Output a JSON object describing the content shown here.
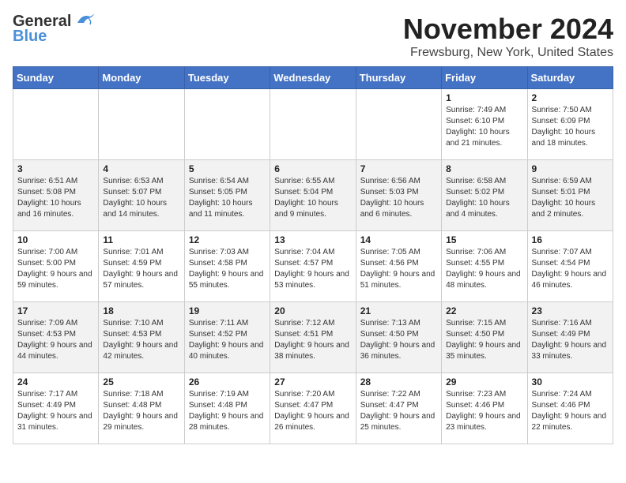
{
  "header": {
    "logo_line1": "General",
    "logo_line2": "Blue",
    "month_year": "November 2024",
    "location": "Frewsburg, New York, United States"
  },
  "weekdays": [
    "Sunday",
    "Monday",
    "Tuesday",
    "Wednesday",
    "Thursday",
    "Friday",
    "Saturday"
  ],
  "weeks": [
    [
      {
        "day": "",
        "info": ""
      },
      {
        "day": "",
        "info": ""
      },
      {
        "day": "",
        "info": ""
      },
      {
        "day": "",
        "info": ""
      },
      {
        "day": "",
        "info": ""
      },
      {
        "day": "1",
        "info": "Sunrise: 7:49 AM\nSunset: 6:10 PM\nDaylight: 10 hours and 21 minutes."
      },
      {
        "day": "2",
        "info": "Sunrise: 7:50 AM\nSunset: 6:09 PM\nDaylight: 10 hours and 18 minutes."
      }
    ],
    [
      {
        "day": "3",
        "info": "Sunrise: 6:51 AM\nSunset: 5:08 PM\nDaylight: 10 hours and 16 minutes."
      },
      {
        "day": "4",
        "info": "Sunrise: 6:53 AM\nSunset: 5:07 PM\nDaylight: 10 hours and 14 minutes."
      },
      {
        "day": "5",
        "info": "Sunrise: 6:54 AM\nSunset: 5:05 PM\nDaylight: 10 hours and 11 minutes."
      },
      {
        "day": "6",
        "info": "Sunrise: 6:55 AM\nSunset: 5:04 PM\nDaylight: 10 hours and 9 minutes."
      },
      {
        "day": "7",
        "info": "Sunrise: 6:56 AM\nSunset: 5:03 PM\nDaylight: 10 hours and 6 minutes."
      },
      {
        "day": "8",
        "info": "Sunrise: 6:58 AM\nSunset: 5:02 PM\nDaylight: 10 hours and 4 minutes."
      },
      {
        "day": "9",
        "info": "Sunrise: 6:59 AM\nSunset: 5:01 PM\nDaylight: 10 hours and 2 minutes."
      }
    ],
    [
      {
        "day": "10",
        "info": "Sunrise: 7:00 AM\nSunset: 5:00 PM\nDaylight: 9 hours and 59 minutes."
      },
      {
        "day": "11",
        "info": "Sunrise: 7:01 AM\nSunset: 4:59 PM\nDaylight: 9 hours and 57 minutes."
      },
      {
        "day": "12",
        "info": "Sunrise: 7:03 AM\nSunset: 4:58 PM\nDaylight: 9 hours and 55 minutes."
      },
      {
        "day": "13",
        "info": "Sunrise: 7:04 AM\nSunset: 4:57 PM\nDaylight: 9 hours and 53 minutes."
      },
      {
        "day": "14",
        "info": "Sunrise: 7:05 AM\nSunset: 4:56 PM\nDaylight: 9 hours and 51 minutes."
      },
      {
        "day": "15",
        "info": "Sunrise: 7:06 AM\nSunset: 4:55 PM\nDaylight: 9 hours and 48 minutes."
      },
      {
        "day": "16",
        "info": "Sunrise: 7:07 AM\nSunset: 4:54 PM\nDaylight: 9 hours and 46 minutes."
      }
    ],
    [
      {
        "day": "17",
        "info": "Sunrise: 7:09 AM\nSunset: 4:53 PM\nDaylight: 9 hours and 44 minutes."
      },
      {
        "day": "18",
        "info": "Sunrise: 7:10 AM\nSunset: 4:53 PM\nDaylight: 9 hours and 42 minutes."
      },
      {
        "day": "19",
        "info": "Sunrise: 7:11 AM\nSunset: 4:52 PM\nDaylight: 9 hours and 40 minutes."
      },
      {
        "day": "20",
        "info": "Sunrise: 7:12 AM\nSunset: 4:51 PM\nDaylight: 9 hours and 38 minutes."
      },
      {
        "day": "21",
        "info": "Sunrise: 7:13 AM\nSunset: 4:50 PM\nDaylight: 9 hours and 36 minutes."
      },
      {
        "day": "22",
        "info": "Sunrise: 7:15 AM\nSunset: 4:50 PM\nDaylight: 9 hours and 35 minutes."
      },
      {
        "day": "23",
        "info": "Sunrise: 7:16 AM\nSunset: 4:49 PM\nDaylight: 9 hours and 33 minutes."
      }
    ],
    [
      {
        "day": "24",
        "info": "Sunrise: 7:17 AM\nSunset: 4:49 PM\nDaylight: 9 hours and 31 minutes."
      },
      {
        "day": "25",
        "info": "Sunrise: 7:18 AM\nSunset: 4:48 PM\nDaylight: 9 hours and 29 minutes."
      },
      {
        "day": "26",
        "info": "Sunrise: 7:19 AM\nSunset: 4:48 PM\nDaylight: 9 hours and 28 minutes."
      },
      {
        "day": "27",
        "info": "Sunrise: 7:20 AM\nSunset: 4:47 PM\nDaylight: 9 hours and 26 minutes."
      },
      {
        "day": "28",
        "info": "Sunrise: 7:22 AM\nSunset: 4:47 PM\nDaylight: 9 hours and 25 minutes."
      },
      {
        "day": "29",
        "info": "Sunrise: 7:23 AM\nSunset: 4:46 PM\nDaylight: 9 hours and 23 minutes."
      },
      {
        "day": "30",
        "info": "Sunrise: 7:24 AM\nSunset: 4:46 PM\nDaylight: 9 hours and 22 minutes."
      }
    ]
  ]
}
